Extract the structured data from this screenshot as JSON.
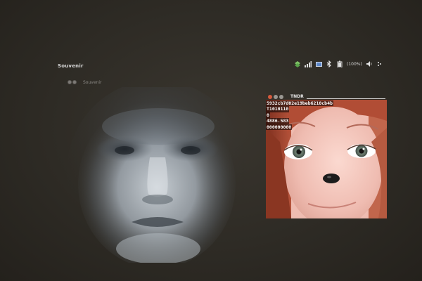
{
  "panel": {
    "app_title": "Souvenir",
    "tray": {
      "icons": [
        "network-icon",
        "signal-icon",
        "mail-icon",
        "bluetooth-icon",
        "battery-icon",
        "volume-icon",
        "session-icon"
      ],
      "battery_text": "(100%)"
    }
  },
  "left_window": {
    "title": "Souvenir",
    "content": "averaged-face-image"
  },
  "right_window": {
    "title": "TNDR",
    "info_lines": [
      "5932cb7d02e19beb6210cb4b",
      "T1010110",
      "0",
      "4886.583",
      "000000000"
    ],
    "content": "face-photo-with-dog-nose-filter"
  },
  "colors": {
    "screen_background": "#2e2b25",
    "close_button": "#d65a3c",
    "hair": "#a8462e",
    "skin": "#f0c0b8"
  }
}
